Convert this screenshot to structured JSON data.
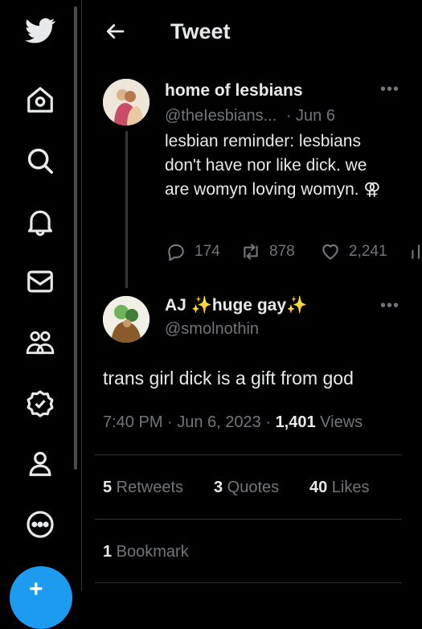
{
  "header": {
    "title": "Tweet"
  },
  "sidebar": {
    "items": [
      "twitter-logo",
      "home",
      "explore",
      "notifications",
      "messages",
      "communities",
      "verified",
      "profile",
      "more"
    ],
    "compose_symbol": "+"
  },
  "parent_tweet": {
    "name": "home of lesbians",
    "handle": "@theIesbians...",
    "date": "· Jun 6",
    "text": "lesbian reminder: lesbians don't have nor like dick. we are womyn loving womyn. ⚢",
    "replies": "174",
    "retweets": "878",
    "likes": "2,241"
  },
  "main_tweet": {
    "name": "AJ ✨huge gay✨",
    "handle": "@smolnothin",
    "text": "trans girl dick is a gift from god",
    "time": "7:40 PM · Jun 6, 2023 · ",
    "views_count": "1,401",
    "views_label": " Views",
    "retweets_count": "5",
    "retweets_label": " Retweets",
    "quotes_count": "3",
    "quotes_label": " Quotes",
    "likes_count": "40",
    "likes_label": " Likes",
    "bookmarks_count": "1",
    "bookmarks_label": " Bookmark"
  },
  "colors": {
    "accent": "#1d9bf0",
    "muted": "#71767b",
    "text": "#e7e9ea",
    "bg": "#000000",
    "border": "#2f3336"
  }
}
